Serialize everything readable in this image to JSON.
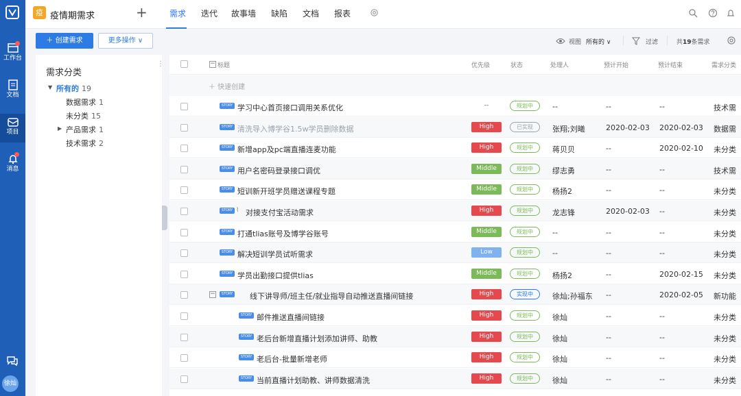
{
  "rail": {
    "items": [
      {
        "label": "工作台",
        "icon": "workbench-icon"
      },
      {
        "label": "文档",
        "icon": "document-icon"
      },
      {
        "label": "项目",
        "icon": "project-icon"
      },
      {
        "label": "消息",
        "icon": "bell-icon"
      }
    ],
    "avatar_text": "徐灿"
  },
  "header": {
    "project_icon_text": "疫",
    "project_name": "疫情期需求",
    "tabs": [
      "需求",
      "迭代",
      "故事墙",
      "缺陷",
      "文档",
      "报表"
    ],
    "active_tab": "需求"
  },
  "toolbar": {
    "create_label": "＋  创建需求",
    "more_label": "更多操作 ∨",
    "view_label": "视图",
    "view_value": "所有的 ∨",
    "filter_label": "过滤",
    "count_prefix": "共",
    "count_number": "19",
    "count_suffix": "条需求"
  },
  "categories": {
    "title": "需求分类",
    "items": [
      {
        "name": "所有的",
        "count": "19"
      },
      {
        "name": "数据需求",
        "count": "1"
      },
      {
        "name": "未分类",
        "count": "15"
      },
      {
        "name": "产品需求",
        "count": "1"
      },
      {
        "name": "技术需求",
        "count": "2"
      }
    ]
  },
  "table": {
    "columns": [
      "标题",
      "优先级",
      "状态",
      "处理人",
      "预计开始",
      "预计结束",
      "需求分类"
    ],
    "quick_create": "＋ 快速创建",
    "story_tag": "STORY",
    "rows": [
      {
        "title": "学习中心首页接口调用关系优化",
        "priority": "--",
        "status": "规划中",
        "owner": "--",
        "start": "--",
        "end": "--",
        "category": "技术需"
      },
      {
        "title": "清洗导入博学谷1.5w学员删除数据",
        "priority": "High",
        "status": "已实现",
        "owner": "张翔;刘曦",
        "start": "2020-02-03",
        "end": "2020-02-03",
        "category": "数据需"
      },
      {
        "title": "新增app及pc端直播连麦功能",
        "priority": "High",
        "status": "规划中",
        "owner": "蒋贝贝",
        "start": "--",
        "end": "2020-02-10",
        "category": "未分类"
      },
      {
        "title": "用户名密码登录接口调优",
        "priority": "Middle",
        "status": "规划中",
        "owner": "缪志勇",
        "start": "--",
        "end": "--",
        "category": "技术需"
      },
      {
        "title": "短训新开班学员赠送课程专题",
        "priority": "Middle",
        "status": "规划中",
        "owner": "杨扬2",
        "start": "--",
        "end": "--",
        "category": "未分类"
      },
      {
        "title": "对接支付宝活动需求",
        "priority": "High",
        "status": "规划中",
        "owner": "龙志锋",
        "start": "2020-02-03",
        "end": "--",
        "category": "未分类"
      },
      {
        "title": "打通tlias账号及博学谷账号",
        "priority": "Middle",
        "status": "规划中",
        "owner": "--",
        "start": "--",
        "end": "--",
        "category": "未分类"
      },
      {
        "title": "解决短训学员试听需求",
        "priority": "Low",
        "status": "规划中",
        "owner": "--",
        "start": "--",
        "end": "--",
        "category": "未分类"
      },
      {
        "title": "学员出勤接口提供tlias",
        "priority": "Middle",
        "status": "规划中",
        "owner": "杨扬2",
        "start": "--",
        "end": "2020-02-15",
        "category": "未分类"
      },
      {
        "title": "线下讲导师/班主任/就业指导自动推送直播间链接",
        "priority": "High",
        "status": "实现中",
        "owner": "徐灿;孙福东",
        "start": "--",
        "end": "2020-02-05",
        "category": "新功能"
      },
      {
        "title": "邮件推送直播间链接",
        "priority": "High",
        "status": "规划中",
        "owner": "徐灿",
        "start": "--",
        "end": "--",
        "category": "未分类"
      },
      {
        "title": "老后台新增直播计划添加讲师、助教",
        "priority": "High",
        "status": "规划中",
        "owner": "徐灿",
        "start": "--",
        "end": "--",
        "category": "未分类"
      },
      {
        "title": "老后台-批量新增老师",
        "priority": "High",
        "status": "规划中",
        "owner": "徐灿",
        "start": "--",
        "end": "--",
        "category": "未分类"
      },
      {
        "title": "当前直播计划助教、讲师数据清洗",
        "priority": "High",
        "status": "规划中",
        "owner": "徐灿",
        "start": "--",
        "end": "--",
        "category": "未分类"
      }
    ]
  },
  "colors": {
    "accent": "#2d7be5",
    "high": "#e5484d",
    "middle": "#7cba59",
    "low": "#7fb2ef",
    "rail": "#1f5fb8"
  }
}
